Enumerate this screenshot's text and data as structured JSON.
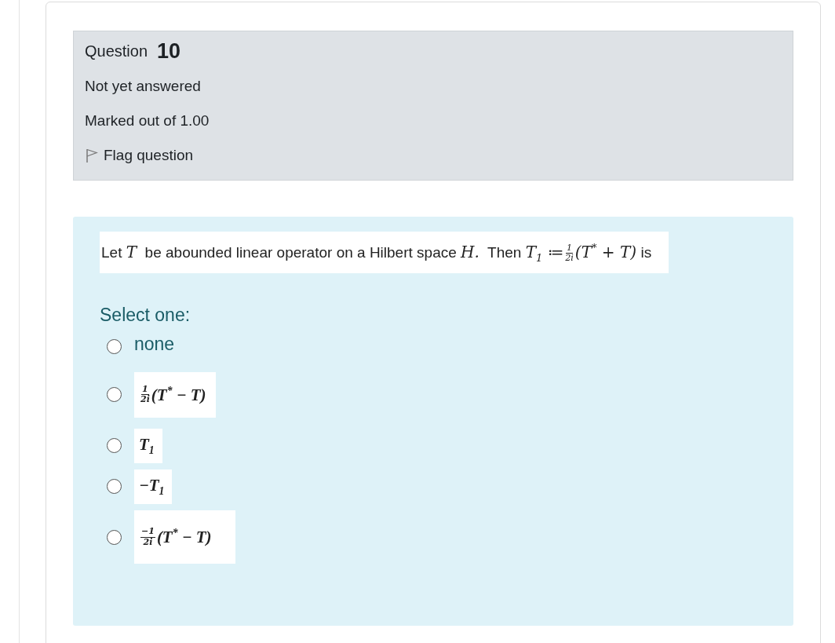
{
  "info": {
    "label": "Question",
    "number": "10",
    "state": "Not yet answered",
    "mark": "Marked out of 1.00",
    "flag": "Flag question",
    "flagged": false
  },
  "question": [
    {
      "kind": "text",
      "text": "Let "
    },
    {
      "kind": "math",
      "text": "T"
    },
    {
      "kind": "text",
      "text": "  be abounded linear operator on a Hilbert space "
    },
    {
      "kind": "math",
      "text": "H."
    },
    {
      "kind": "text",
      "text": "  Then "
    },
    {
      "kind": "math",
      "text": "T$_{1}$ ≔"
    },
    {
      "kind": "frac",
      "num": "1",
      "den": "2i"
    },
    {
      "kind": "math",
      "text": "(T$^{*}$ + T)"
    },
    {
      "kind": "text",
      "text": " is"
    }
  ],
  "prompt": "Select one:",
  "options": [
    {
      "selected": false,
      "kind": "text",
      "content": [
        {
          "kind": "text",
          "text": "none"
        }
      ]
    },
    {
      "selected": false,
      "kind": "image",
      "content": [
        {
          "kind": "frac",
          "num": "1",
          "den": "2i"
        },
        {
          "kind": "math",
          "text": "(T$^{*}$ − T)"
        }
      ]
    },
    {
      "selected": false,
      "kind": "image",
      "content": [
        {
          "kind": "math",
          "text": "T$_{1}$"
        }
      ]
    },
    {
      "selected": false,
      "kind": "image",
      "content": [
        {
          "kind": "math",
          "text": "−T$_{1}$"
        }
      ]
    },
    {
      "selected": false,
      "kind": "image",
      "content": [
        {
          "kind": "frac",
          "num": "−1",
          "den": "2i"
        },
        {
          "kind": "math",
          "text": "(T$^{*}$ − T)"
        }
      ]
    }
  ]
}
